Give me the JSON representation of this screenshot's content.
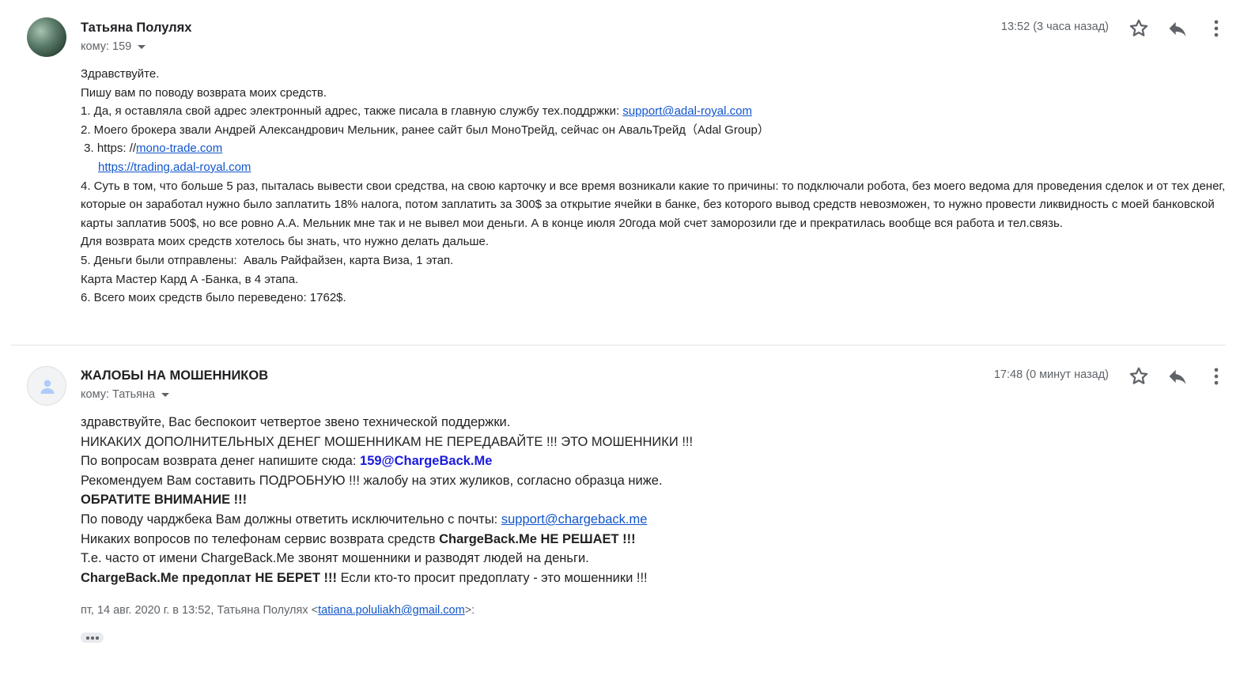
{
  "message1": {
    "sender": "Татьяна Полулях",
    "to": "кому: 159",
    "time": "13:52 (3 часа назад)",
    "body": {
      "l1": "Здравствуйте.",
      "l2": "Пишу вам по поводу возврата моих средств.",
      "l3_text": "1. Да,  я оставляла свой адрес электронный адрес, также писала в главную службу тех.поддржки: ",
      "l3_link": "support@adal-royal.com",
      "l4": "2. Моего брокера звали Андрей Александрович Мельник, ранее сайт был МоноТрейд, сейчас он АвальТрейд（Adal Group）",
      "l5_text": " 3. https: //",
      "l5_link": "mono-trade.com",
      "l6_link": "https://trading.adal-royal.com",
      "l7": "4. Суть в том, что больше 5 раз, пыталась вывести свои средства, на свою карточку и все время возникали какие то причины: то подключали робота, без моего ведома для проведения сделок и от тех денег, которые он заработал нужно было заплатить 18% налога, потом заплатить за 300$ за открытие ячейки в банке, без которого вывод средств невозможен, то нужно провести ликвидность с моей банковской карты заплатив 500$, но все ровно А.А. Мельник мне так и не вывел мои деньги. А в конце июля 20года мой счет заморозили где и прекратилась вообще вся работа и тел.связь.",
      "l8": "Для возврата моих средств хотелось бы знать, что нужно делать дальше.",
      "l9": "5. Деньги были отправлены:  Аваль Райфайзен, карта Виза, 1 этап.",
      "l10": "Карта Мастер Кард А -Банка, в 4 этапа.",
      "l11": "6. Всего моих средств было переведено: 1762$."
    }
  },
  "message2": {
    "sender": "ЖАЛОБЫ НА МОШЕННИКОВ",
    "to": "кому: Татьяна",
    "time": "17:48 (0 минут назад)",
    "body": {
      "l1": "здравствуйте, Вас беспокоит четвертое звено технической поддержки.",
      "l2": "НИКАКИХ ДОПОЛНИТЕЛЬНЫХ ДЕНЕГ МОШЕННИКАМ НЕ ПЕРЕДАВАЙТЕ !!! ЭТО МОШЕННИКИ !!!",
      "l3_text": "По вопросам возврата денег напишите сюда: ",
      "l3_email": "159@ChargeBack.Me",
      "l4": "Рекомендуем Вам составить ПОДРОБНУЮ !!! жалобу на этих жуликов, согласно образца ниже.",
      "l5": "ОБРАТИТЕ ВНИМАНИЕ !!!",
      "l6_text": "По поводу чарджбека Вам должны ответить исключительно с почты: ",
      "l6_link": "support@chargeback.me",
      "l7_text": "Никаких вопросов по телефонам сервис возврата средств ",
      "l7_bold": "ChargeBack.Me НЕ РЕШАЕТ !!!",
      "l8": "Т.е. часто от имени ChargeBack.Me звонят мошенники и разводят людей на деньги.",
      "l9_bold": "ChargeBack.Me предоплат НЕ БЕРЕТ !!!",
      "l9_text": " Если кто-то просит предоплату - это мошенники !!!"
    },
    "quote_prefix": "пт, 14 авг. 2020 г. в 13:52, Татьяна Полулях <",
    "quote_email": "tatiana.poluliakh@gmail.com",
    "quote_suffix": ">:"
  },
  "icons": [
    "star-icon",
    "reply-icon",
    "more-vert-icon",
    "person-icon",
    "caret-down-icon"
  ],
  "colors": {
    "link": "#1155cc",
    "email_highlight": "#1a1adc",
    "muted": "#5f6368"
  }
}
